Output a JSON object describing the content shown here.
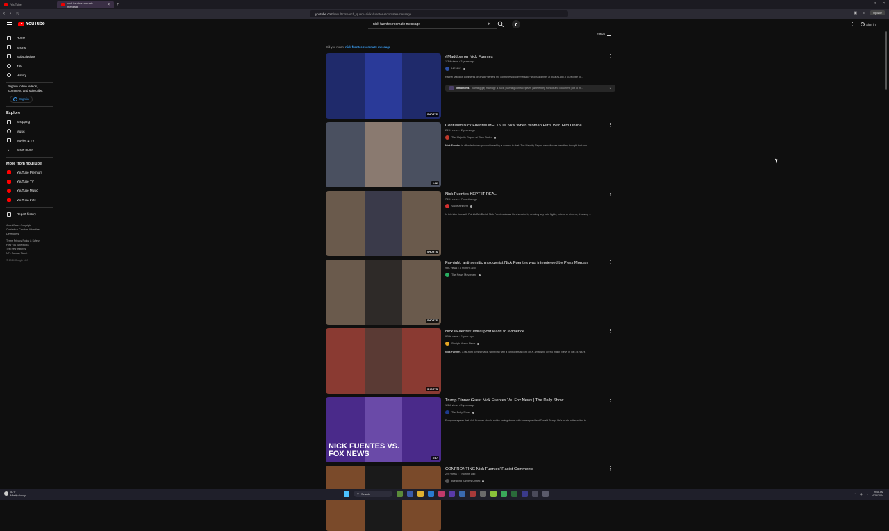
{
  "browser": {
    "tabs": [
      {
        "label": "YouTube",
        "active": false
      },
      {
        "label": "nick fuentes roomate message",
        "active": true
      }
    ],
    "url_host": "youtube.com",
    "url_path": "/results?search_query=nick+fuentes+roomate+message",
    "update_label": "Update"
  },
  "header": {
    "logo": "YouTube",
    "search_value": "nick fuentes roomate message",
    "signin_label": "Sign in"
  },
  "sidebar": {
    "main": [
      {
        "label": "Home",
        "icon": "home-icon"
      },
      {
        "label": "Shorts",
        "icon": "shorts-icon"
      },
      {
        "label": "Subscriptions",
        "icon": "subscriptions-icon"
      }
    ],
    "you": [
      {
        "label": "You",
        "icon": "you-icon"
      },
      {
        "label": "History",
        "icon": "history-icon"
      }
    ],
    "signin_text": "Sign in to like videos, comment, and subscribe.",
    "signin_button": "Sign in",
    "explore_heading": "Explore",
    "explore": [
      {
        "label": "Shopping",
        "icon": "shopping-icon"
      },
      {
        "label": "Music",
        "icon": "music-icon"
      },
      {
        "label": "Movies & TV",
        "icon": "movies-icon"
      },
      {
        "label": "Show more",
        "icon": "chevron-down-icon"
      }
    ],
    "more_heading": "More from YouTube",
    "more": [
      {
        "label": "YouTube Premium"
      },
      {
        "label": "YouTube TV"
      },
      {
        "label": "YouTube Music"
      },
      {
        "label": "YouTube Kids"
      }
    ],
    "report_history": "Report history",
    "footer1": "About  Press  Copyright",
    "footer2": "Contact us  Creators  Advertise",
    "footer3": "Developers",
    "footer4": "Terms  Privacy  Policy & Safety",
    "footer5": "How YouTube works",
    "footer6": "Test new features",
    "footer7": "NFL Sunday Ticket",
    "copyright": "© 2024 Google LLC"
  },
  "results": {
    "did_you_mean_prefix": "Did you mean:",
    "did_you_mean_query": "nick fuentes roommate message",
    "filters_label": "Filters",
    "items": [
      {
        "title": "#Maddow on Nick Fuentes",
        "meta": "1.3M views • 3 years ago",
        "channel": "MSNBC",
        "channel_color": "#2c4fa3",
        "desc_bold": "",
        "desc": "Rachel Maddow comments on #NickFuentes, the controversial commentator who had dinner at #MarALago. • Subscribe to ...",
        "badge": "SHORTS",
        "chapters_bold": "5 moments",
        "chapters": "Banning gay marriage is back | Banning contraceptives | where they monitor and document | cut to th...",
        "thumb_bg": "#1f2a6b",
        "thumb_inner": "#2a3a99"
      },
      {
        "title": "Confused Nick Fuentes MELTS DOWN When Woman Flirts With Him Online",
        "meta": "261K views • 2 years ago",
        "channel": "The Majority Report w/ Sam Seder",
        "channel_color": "#c0392b",
        "desc_bold": "Nick Fuentes",
        "desc": " is offended when 'propositioned' by a woman in chat. The Majority Report crew discuss how they thought that was ...",
        "badge": "9:52",
        "thumb_bg": "#4a5060",
        "thumb_inner": "#8a7a70"
      },
      {
        "title": "Nick Fuentes KEPT IT REAL",
        "meta": "749K views • 7 months ago",
        "channel": "Valuetainment",
        "channel_color": "#d32f2f",
        "desc_bold": "",
        "desc": "In this interview with Patrick Bet-David, Nick Fuentes shows his character by refusing any paid flights, hotels, or dinners, choosing ...",
        "badge": "SHORTS",
        "thumb_bg": "#6a5a4c",
        "thumb_inner": "#3a3a4a"
      },
      {
        "title": "Far-right, anti-semitic misogynist Nick Fuentes was interviewed by Piers Morgan",
        "meta": "99K views • 4 months ago",
        "channel": "The News Movement",
        "channel_color": "#27ae60",
        "desc_bold": "",
        "desc": "",
        "badge": "SHORTS",
        "thumb_bg": "#6a5a4c",
        "thumb_inner": "#2e2a28"
      },
      {
        "title": "Nick #Fuentes' #viral post leads to #violence",
        "meta": "909K views • 1 year ago",
        "channel": "Straight Arrow News",
        "channel_color": "#e6a623",
        "desc_bold": "Nick Fuentes",
        "desc": ", a far-right commentator, went viral with a controversial post on X, amassing over 5 million views in just 24 hours.",
        "badge": "SHORTS",
        "thumb_bg": "#8a3a32",
        "thumb_inner": "#5a3a34"
      },
      {
        "title": "Trump Dinner Guest Nick Fuentes Vs. Fox News | The Daily Show",
        "meta": "1.3M views • 3 years ago",
        "channel": "The Daily Show",
        "channel_color": "#1d3b8a",
        "desc_bold": "",
        "desc": "Everyone agrees that Nick Fuentes should not be having dinner with former president Donald Trump. He's much better suited to ...",
        "badge": "3:37",
        "overlay": "NICK FUENTES VS. FOX NEWS",
        "thumb_bg": "#4a2a8a",
        "thumb_inner": "#6a4aa8"
      },
      {
        "title": "CONFRONTING Nick Fuentes' Racist Comments",
        "meta": "276 views • 7 months ago",
        "channel": "Breaking Barriers United",
        "channel_color": "#555",
        "desc_bold": "",
        "desc": "",
        "badge": "",
        "thumb_bg": "#7a4a2a",
        "thumb_inner": "#1a1a1a"
      }
    ]
  },
  "taskbar": {
    "weather_temp": "57°F",
    "weather_desc": "Mostly cloudy",
    "search_label": "Search",
    "time": "9:45 AM",
    "date": "4/29/2024"
  }
}
